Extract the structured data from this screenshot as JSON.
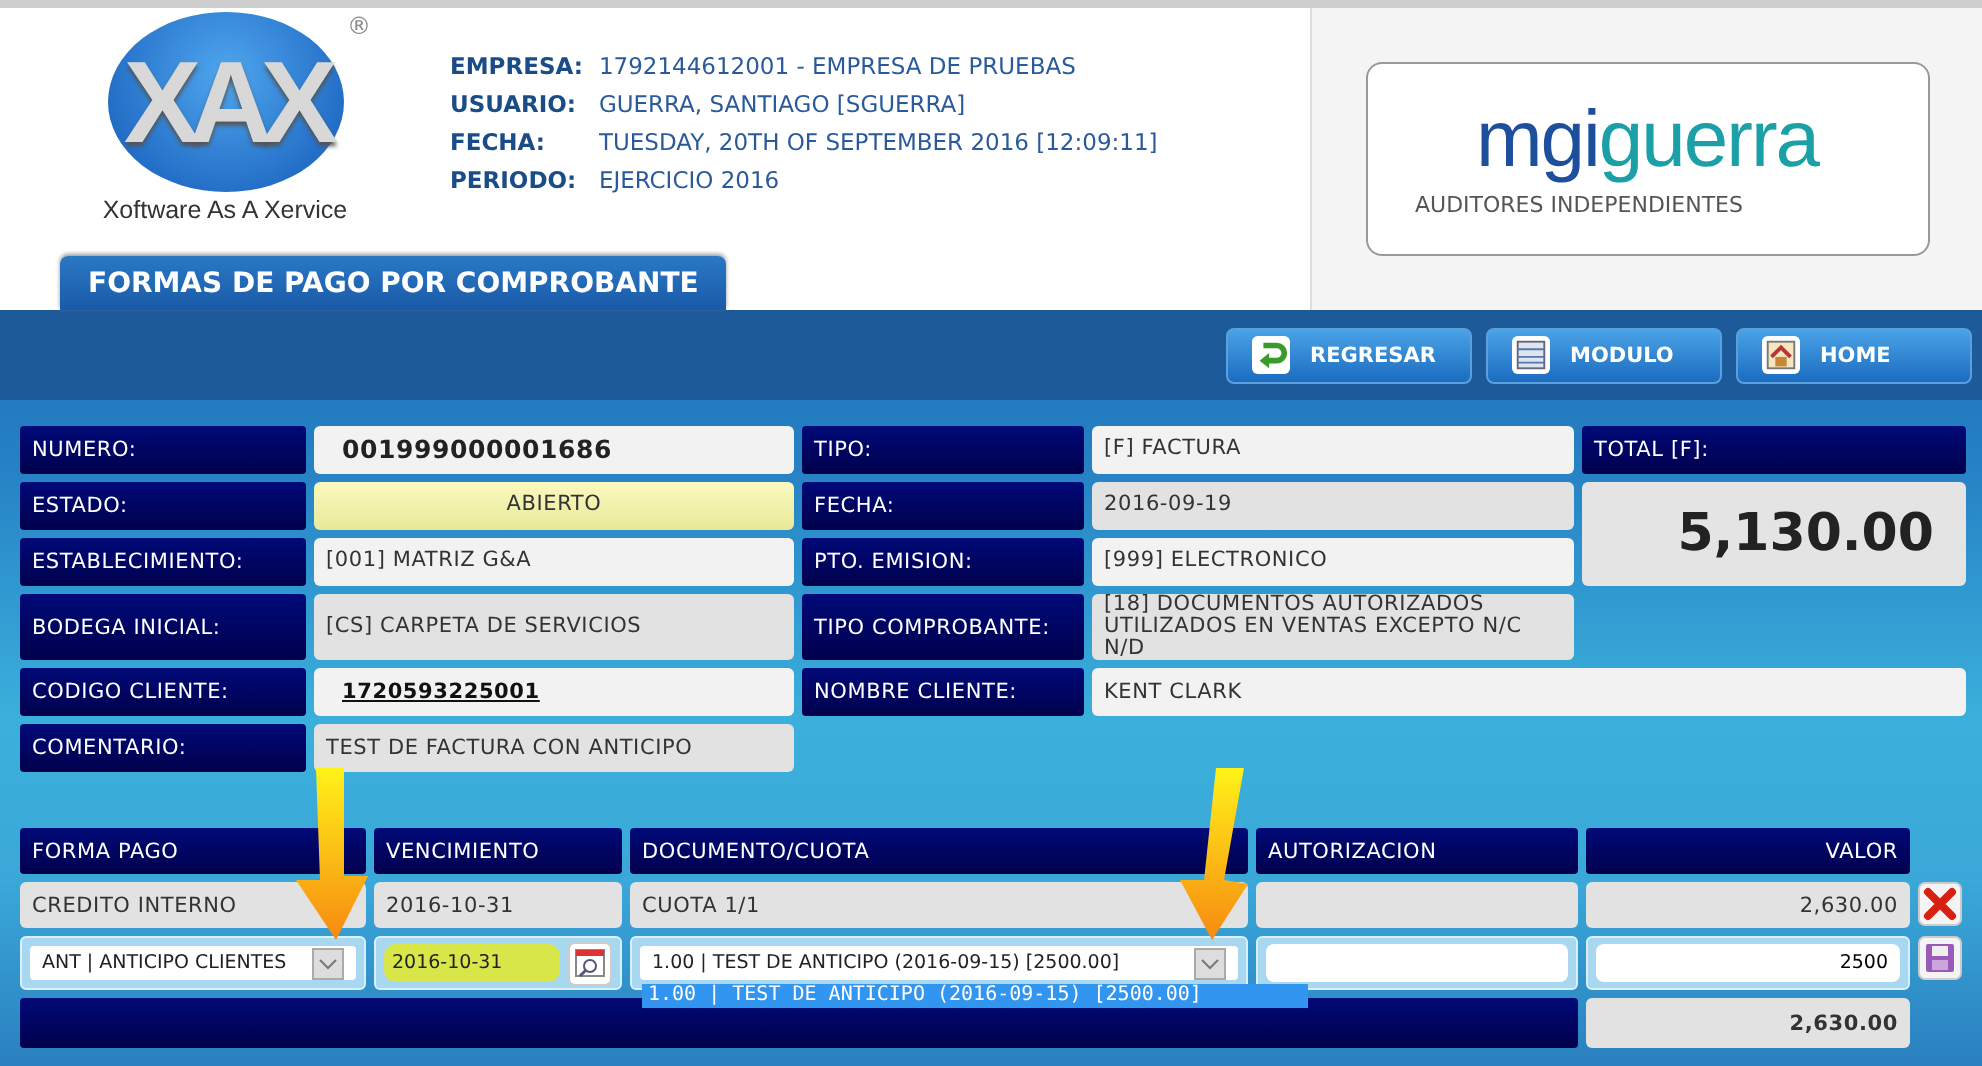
{
  "header": {
    "logo": {
      "mark": "XAX",
      "registered": "®",
      "tagline": "Xoftware As A Xervice"
    },
    "info": [
      {
        "label": "EMPRESA:",
        "value": "1792144612001 - EMPRESA DE PRUEBAS"
      },
      {
        "label": "USUARIO:",
        "value": "GUERRA, SANTIAGO [SGUERRA]"
      },
      {
        "label": "FECHA:",
        "value": "TUESDAY, 20TH OF SEPTEMBER 2016 [12:09:11]"
      },
      {
        "label": "PERIODO:",
        "value": "EJERCICIO 2016"
      }
    ],
    "partner_logo": {
      "name_parts": [
        "mgi",
        "guerra"
      ],
      "subtitle": "AUDITORES INDEPENDIENTES"
    }
  },
  "page_tab": {
    "title": "FORMAS DE PAGO POR COMPROBANTE"
  },
  "toolbar": [
    {
      "label": "REGRESAR",
      "kind": "back"
    },
    {
      "label": "MODULO",
      "kind": "module"
    },
    {
      "label": "HOME",
      "kind": "home"
    }
  ],
  "form": {
    "left_fields": [
      {
        "label": "NUMERO:",
        "value": "001999000001686",
        "kind": "number"
      },
      {
        "label": "ESTADO:",
        "value": "ABIERTO",
        "kind": "status"
      },
      {
        "label": "ESTABLECIMIENTO:",
        "value": "[001] MATRIZ G&A",
        "kind": "text"
      },
      {
        "label": "BODEGA INICIAL:",
        "value": "[CS] CARPETA DE SERVICIOS",
        "kind": "readonly"
      },
      {
        "label": "CODIGO CLIENTE:",
        "value": "1720593225001",
        "kind": "link"
      },
      {
        "label": "COMENTARIO:",
        "value": "TEST DE FACTURA CON ANTICIPO",
        "kind": "readonly"
      }
    ],
    "right_fields": [
      {
        "label": "TIPO:",
        "value": "[F] FACTURA",
        "kind": "text"
      },
      {
        "label": "FECHA:",
        "value": "2016-09-19",
        "kind": "readonly"
      },
      {
        "label": "PTO. EMISION:",
        "value": "[999] ELECTRONICO",
        "kind": "text"
      },
      {
        "label": "TIPO COMPROBANTE:",
        "value": "[18] DOCUMENTOS AUTORIZADOS UTILIZADOS EN VENTAS EXCEPTO N/C N/D",
        "kind": "readonly"
      },
      {
        "label": "NOMBRE CLIENTE:",
        "value": "KENT CLARK",
        "kind": "text"
      }
    ],
    "total": {
      "label": "TOTAL [F]:",
      "value": "5,130.00"
    }
  },
  "payments": {
    "columns": [
      "FORMA PAGO",
      "VENCIMIENTO",
      "DOCUMENTO/CUOTA",
      "AUTORIZACION",
      "VALOR"
    ],
    "rows": [
      {
        "forma_pago": "CREDITO INTERNO",
        "vencimiento": "2016-10-31",
        "documento": "CUOTA 1/1",
        "valor": "2,630.00"
      }
    ],
    "edit_row": {
      "forma_pago": "ANT | ANTICIPO CLIENTES",
      "vencimiento": "2016-10-31",
      "documento": {
        "value": "1.00 | TEST DE ANTICIPO (2016-09-15) [2500.00]",
        "expanded": true,
        "options": [
          {
            "label": "1.00 | TEST DE ANTICIPO (2016-09-15) [2500.00]",
            "selected": true
          }
        ]
      },
      "valor": "2500"
    },
    "total": "2,630.00"
  }
}
